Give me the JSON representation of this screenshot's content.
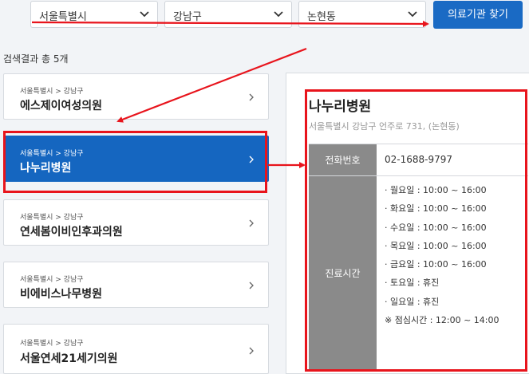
{
  "search": {
    "city": "서울특별시",
    "district": "강남구",
    "dong": "논현동",
    "submit_label": "의료기관 찾기"
  },
  "results": {
    "count_text": "검색결과 총 5개",
    "items": [
      {
        "location": "서울특별시 > 강남구",
        "name": "에스제이여성의원"
      },
      {
        "location": "서울특별시 > 강남구",
        "name": "나누리병원"
      },
      {
        "location": "서울특별시 > 강남구",
        "name": "연세봄이비인후과의원"
      },
      {
        "location": "서울특별시 > 강남구",
        "name": "비에비스나무병원"
      },
      {
        "location": "서울특별시 > 강남구",
        "name": "서울연세21세기의원"
      }
    ]
  },
  "detail": {
    "name": "나누리병원",
    "address": "서울특별시 강남구 언주로 731, (논현동)",
    "phone_label": "전화번호",
    "phone": "02-1688-9797",
    "hours_label": "진료시간",
    "hours": [
      "· 월요일 : 10:00 ~ 16:00",
      "· 화요일 : 10:00 ~ 16:00",
      "· 수요일 : 10:00 ~ 16:00",
      "· 목요일 : 10:00 ~ 16:00",
      "· 금요일 : 10:00 ~ 16:00",
      "· 토요일 : 휴진",
      "· 일요일 : 휴진",
      "※ 점심시간 : 12:00 ~ 14:00"
    ]
  },
  "colors": {
    "primary": "#1566c0",
    "annotation": "#e8141c",
    "header_cell": "#8a8a8a"
  }
}
